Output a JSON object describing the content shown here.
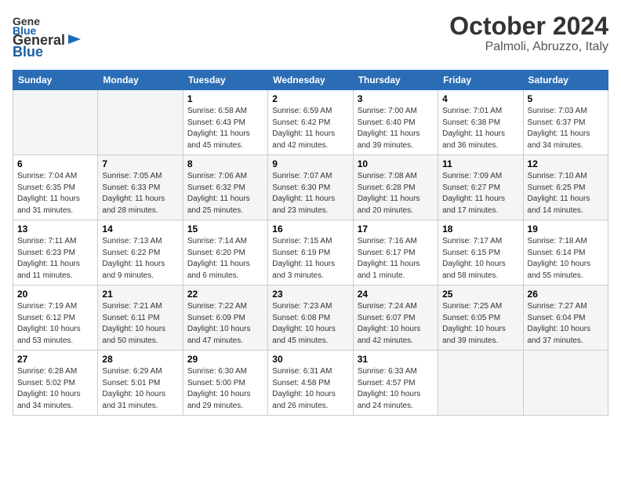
{
  "header": {
    "logo_general": "General",
    "logo_blue": "Blue",
    "title": "October 2024",
    "subtitle": "Palmoli, Abruzzo, Italy"
  },
  "calendar": {
    "days_of_week": [
      "Sunday",
      "Monday",
      "Tuesday",
      "Wednesday",
      "Thursday",
      "Friday",
      "Saturday"
    ],
    "rows": [
      [
        {
          "day": "",
          "info": ""
        },
        {
          "day": "",
          "info": ""
        },
        {
          "day": "1",
          "info": "Sunrise: 6:58 AM\nSunset: 6:43 PM\nDaylight: 11 hours and 45 minutes."
        },
        {
          "day": "2",
          "info": "Sunrise: 6:59 AM\nSunset: 6:42 PM\nDaylight: 11 hours and 42 minutes."
        },
        {
          "day": "3",
          "info": "Sunrise: 7:00 AM\nSunset: 6:40 PM\nDaylight: 11 hours and 39 minutes."
        },
        {
          "day": "4",
          "info": "Sunrise: 7:01 AM\nSunset: 6:38 PM\nDaylight: 11 hours and 36 minutes."
        },
        {
          "day": "5",
          "info": "Sunrise: 7:03 AM\nSunset: 6:37 PM\nDaylight: 11 hours and 34 minutes."
        }
      ],
      [
        {
          "day": "6",
          "info": "Sunrise: 7:04 AM\nSunset: 6:35 PM\nDaylight: 11 hours and 31 minutes."
        },
        {
          "day": "7",
          "info": "Sunrise: 7:05 AM\nSunset: 6:33 PM\nDaylight: 11 hours and 28 minutes."
        },
        {
          "day": "8",
          "info": "Sunrise: 7:06 AM\nSunset: 6:32 PM\nDaylight: 11 hours and 25 minutes."
        },
        {
          "day": "9",
          "info": "Sunrise: 7:07 AM\nSunset: 6:30 PM\nDaylight: 11 hours and 23 minutes."
        },
        {
          "day": "10",
          "info": "Sunrise: 7:08 AM\nSunset: 6:28 PM\nDaylight: 11 hours and 20 minutes."
        },
        {
          "day": "11",
          "info": "Sunrise: 7:09 AM\nSunset: 6:27 PM\nDaylight: 11 hours and 17 minutes."
        },
        {
          "day": "12",
          "info": "Sunrise: 7:10 AM\nSunset: 6:25 PM\nDaylight: 11 hours and 14 minutes."
        }
      ],
      [
        {
          "day": "13",
          "info": "Sunrise: 7:11 AM\nSunset: 6:23 PM\nDaylight: 11 hours and 11 minutes."
        },
        {
          "day": "14",
          "info": "Sunrise: 7:13 AM\nSunset: 6:22 PM\nDaylight: 11 hours and 9 minutes."
        },
        {
          "day": "15",
          "info": "Sunrise: 7:14 AM\nSunset: 6:20 PM\nDaylight: 11 hours and 6 minutes."
        },
        {
          "day": "16",
          "info": "Sunrise: 7:15 AM\nSunset: 6:19 PM\nDaylight: 11 hours and 3 minutes."
        },
        {
          "day": "17",
          "info": "Sunrise: 7:16 AM\nSunset: 6:17 PM\nDaylight: 11 hours and 1 minute."
        },
        {
          "day": "18",
          "info": "Sunrise: 7:17 AM\nSunset: 6:15 PM\nDaylight: 10 hours and 58 minutes."
        },
        {
          "day": "19",
          "info": "Sunrise: 7:18 AM\nSunset: 6:14 PM\nDaylight: 10 hours and 55 minutes."
        }
      ],
      [
        {
          "day": "20",
          "info": "Sunrise: 7:19 AM\nSunset: 6:12 PM\nDaylight: 10 hours and 53 minutes."
        },
        {
          "day": "21",
          "info": "Sunrise: 7:21 AM\nSunset: 6:11 PM\nDaylight: 10 hours and 50 minutes."
        },
        {
          "day": "22",
          "info": "Sunrise: 7:22 AM\nSunset: 6:09 PM\nDaylight: 10 hours and 47 minutes."
        },
        {
          "day": "23",
          "info": "Sunrise: 7:23 AM\nSunset: 6:08 PM\nDaylight: 10 hours and 45 minutes."
        },
        {
          "day": "24",
          "info": "Sunrise: 7:24 AM\nSunset: 6:07 PM\nDaylight: 10 hours and 42 minutes."
        },
        {
          "day": "25",
          "info": "Sunrise: 7:25 AM\nSunset: 6:05 PM\nDaylight: 10 hours and 39 minutes."
        },
        {
          "day": "26",
          "info": "Sunrise: 7:27 AM\nSunset: 6:04 PM\nDaylight: 10 hours and 37 minutes."
        }
      ],
      [
        {
          "day": "27",
          "info": "Sunrise: 6:28 AM\nSunset: 5:02 PM\nDaylight: 10 hours and 34 minutes."
        },
        {
          "day": "28",
          "info": "Sunrise: 6:29 AM\nSunset: 5:01 PM\nDaylight: 10 hours and 31 minutes."
        },
        {
          "day": "29",
          "info": "Sunrise: 6:30 AM\nSunset: 5:00 PM\nDaylight: 10 hours and 29 minutes."
        },
        {
          "day": "30",
          "info": "Sunrise: 6:31 AM\nSunset: 4:58 PM\nDaylight: 10 hours and 26 minutes."
        },
        {
          "day": "31",
          "info": "Sunrise: 6:33 AM\nSunset: 4:57 PM\nDaylight: 10 hours and 24 minutes."
        },
        {
          "day": "",
          "info": ""
        },
        {
          "day": "",
          "info": ""
        }
      ]
    ]
  }
}
